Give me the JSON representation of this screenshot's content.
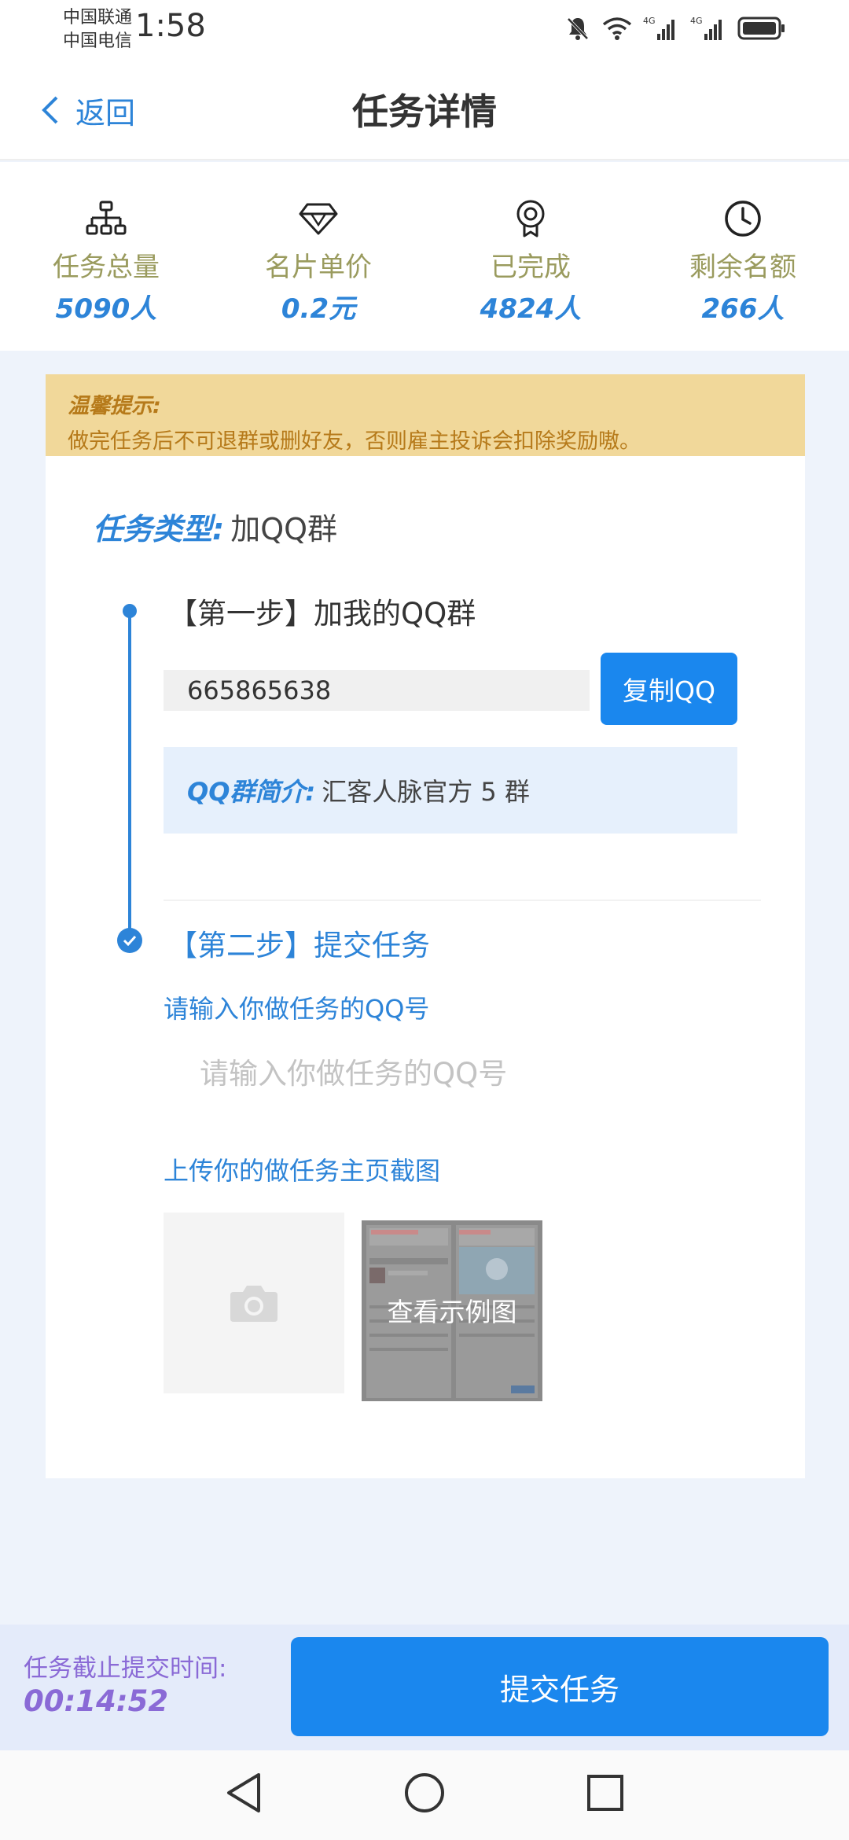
{
  "status_bar": {
    "carrier1": "中国联通",
    "carrier2": "中国电信",
    "time": "1:58",
    "network1": "4G",
    "network2": "4G"
  },
  "header": {
    "back_label": "返回",
    "title": "任务详情"
  },
  "stats": [
    {
      "icon": "hierarchy-icon",
      "label": "任务总量",
      "value": "5090人"
    },
    {
      "icon": "diamond-icon",
      "label": "名片单价",
      "value": "0.2元"
    },
    {
      "icon": "badge-icon",
      "label": "已完成",
      "value": "4824人"
    },
    {
      "icon": "clock-icon",
      "label": "剩余名额",
      "value": "266人"
    }
  ],
  "notice": {
    "title": "温馨提示:",
    "text": "做完任务后不可退群或删好友，否则雇主投诉会扣除奖励嗷。"
  },
  "task": {
    "type_label": "任务类型:",
    "type_value": "加QQ群",
    "step1_title": "【第一步】加我的QQ群",
    "qq_number": "665865638",
    "copy_label": "复制QQ",
    "intro_label": "QQ群简介:",
    "intro_value": "汇客人脉官方 5 群",
    "step2_title": "【第二步】提交任务",
    "qq_input_label": "请输入你做任务的QQ号",
    "qq_input_placeholder": "请输入你做任务的QQ号",
    "upload_label": "上传你的做任务主页截图",
    "example_label": "查看示例图"
  },
  "bottom": {
    "deadline_label": "任务截止提交时间:",
    "deadline_time": "00:14:52",
    "submit_label": "提交任务"
  },
  "colors": {
    "accent": "#1a87ee",
    "accent_text": "#2d84d8",
    "notice_bg": "#f1d89a",
    "notice_text": "#b67a1a",
    "stat_label": "#9a9b5e",
    "deadline": "#8a6ad6"
  }
}
